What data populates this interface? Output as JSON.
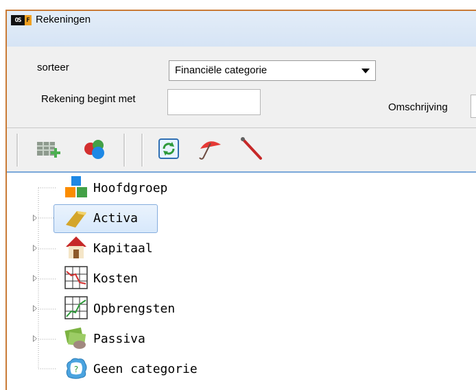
{
  "window": {
    "title": "Rekeningen",
    "app_icon": {
      "text_a": "OS",
      "text_b": "F"
    }
  },
  "filters": {
    "sort_label": "sorteer",
    "sort_value": "Financiële categorie",
    "starts_with_label": "Rekening begint met",
    "starts_with_value": "",
    "description_label": "Omschrijving",
    "description_value": ""
  },
  "toolbar": {
    "buttons": [
      {
        "icon": "add-row-icon"
      },
      {
        "icon": "categories-icon"
      },
      {
        "icon": "refresh-icon"
      },
      {
        "icon": "umbrella-icon"
      },
      {
        "icon": "pen-icon"
      }
    ]
  },
  "tree": {
    "nodes": [
      {
        "label": "Hoofdgroep",
        "icon": "blocks-icon",
        "expandable": false
      },
      {
        "label": "Activa",
        "icon": "gold-bar-icon",
        "expandable": true,
        "selected": true
      },
      {
        "label": "Kapitaal",
        "icon": "house-icon",
        "expandable": true
      },
      {
        "label": "Kosten",
        "icon": "chart-down-icon",
        "expandable": true
      },
      {
        "label": "Opbrengsten",
        "icon": "chart-up-icon",
        "expandable": true
      },
      {
        "label": "Passiva",
        "icon": "money-icon",
        "expandable": true
      },
      {
        "label": "Geen categorie",
        "icon": "question-icon",
        "expandable": false
      }
    ]
  },
  "colors": {
    "selection": "#d7e8fb",
    "selection_border": "#84acdd",
    "toolbar_border": "#7aa7d9",
    "window_frame": "#c97a35"
  }
}
